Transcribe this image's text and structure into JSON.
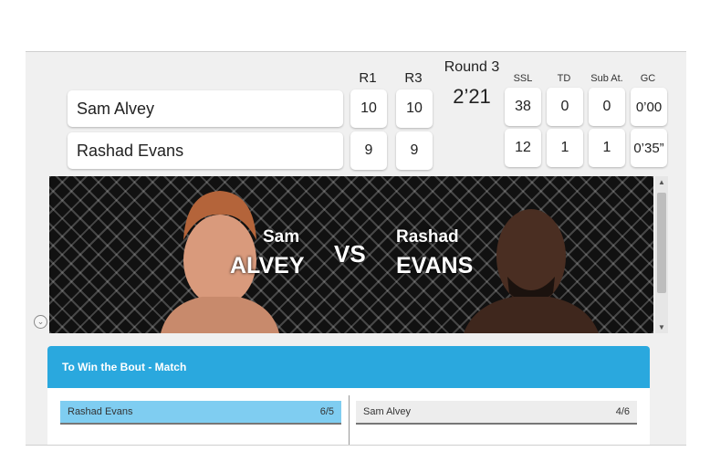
{
  "scoreboard": {
    "headers": {
      "r1": "R1",
      "r3": "R3",
      "ssl": "SSL",
      "td": "TD",
      "sub_att": "Sub At.",
      "gc": "GC"
    },
    "round_label": "Round 3",
    "clock": "2’21",
    "fighters": [
      {
        "name": "Sam Alvey",
        "r1": "10",
        "r3": "10",
        "ssl": "38",
        "td": "0",
        "sub_att": "0",
        "gc": "0’00"
      },
      {
        "name": "Rashad Evans",
        "r1": "9",
        "r3": "9",
        "ssl": "12",
        "td": "1",
        "sub_att": "1",
        "gc": "0’35”"
      }
    ]
  },
  "banner": {
    "left_first": "Sam",
    "left_last": "ALVEY",
    "vs": "VS",
    "right_first": "Rashad",
    "right_last": "EVANS"
  },
  "market": {
    "title": "To Win the Bout - Match",
    "selections": [
      {
        "name": "Rashad Evans",
        "odds": "6/5",
        "selected": true
      },
      {
        "name": "Sam Alvey",
        "odds": "4/6",
        "selected": false
      }
    ]
  },
  "colors": {
    "accent": "#2aa8de",
    "selected": "#7fcdf1"
  }
}
